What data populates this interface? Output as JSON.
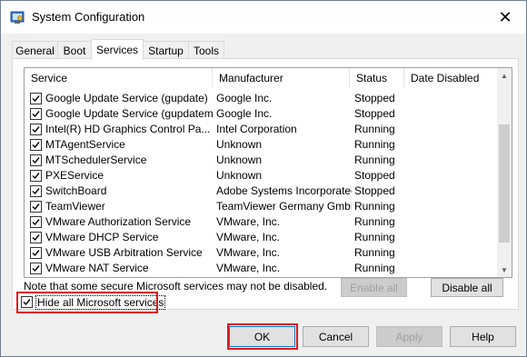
{
  "window": {
    "title": "System Configuration",
    "close_glyph": "✕"
  },
  "tabs": [
    {
      "label": "General",
      "active": false
    },
    {
      "label": "Boot",
      "active": false
    },
    {
      "label": "Services",
      "active": true
    },
    {
      "label": "Startup",
      "active": false
    },
    {
      "label": "Tools",
      "active": false
    }
  ],
  "list": {
    "columns": [
      "Service",
      "Manufacturer",
      "Status",
      "Date Disabled"
    ],
    "rows": [
      {
        "service": "Google Update Service (gupdate)",
        "manufacturer": "Google Inc.",
        "status": "Stopped",
        "checked": true
      },
      {
        "service": "Google Update Service (gupdatem)",
        "manufacturer": "Google Inc.",
        "status": "Stopped",
        "checked": true
      },
      {
        "service": "Intel(R) HD Graphics Control Pa...",
        "manufacturer": "Intel Corporation",
        "status": "Running",
        "checked": true
      },
      {
        "service": "MTAgentService",
        "manufacturer": "Unknown",
        "status": "Running",
        "checked": true
      },
      {
        "service": "MTSchedulerService",
        "manufacturer": "Unknown",
        "status": "Running",
        "checked": true
      },
      {
        "service": "PXEService",
        "manufacturer": "Unknown",
        "status": "Stopped",
        "checked": true
      },
      {
        "service": "SwitchBoard",
        "manufacturer": "Adobe Systems Incorporated",
        "status": "Stopped",
        "checked": true
      },
      {
        "service": "TeamViewer",
        "manufacturer": "TeamViewer Germany GmbH",
        "status": "Running",
        "checked": true
      },
      {
        "service": "VMware Authorization Service",
        "manufacturer": "VMware, Inc.",
        "status": "Running",
        "checked": true
      },
      {
        "service": "VMware DHCP Service",
        "manufacturer": "VMware, Inc.",
        "status": "Running",
        "checked": true
      },
      {
        "service": "VMware USB Arbitration Service",
        "manufacturer": "VMware, Inc.",
        "status": "Running",
        "checked": true
      },
      {
        "service": "VMware NAT Service",
        "manufacturer": "VMware, Inc.",
        "status": "Running",
        "checked": true
      }
    ]
  },
  "note": "Note that some secure Microsoft services may not be disabled.",
  "buttons": {
    "enable_all": "Enable all",
    "disable_all": "Disable all",
    "ok": "OK",
    "cancel": "Cancel",
    "apply": "Apply",
    "help": "Help"
  },
  "hide_ms": {
    "label": "Hide all Microsoft services",
    "checked": true
  },
  "colors": {
    "highlight_box": "#e0191c",
    "default_button_border": "#0078d7"
  }
}
